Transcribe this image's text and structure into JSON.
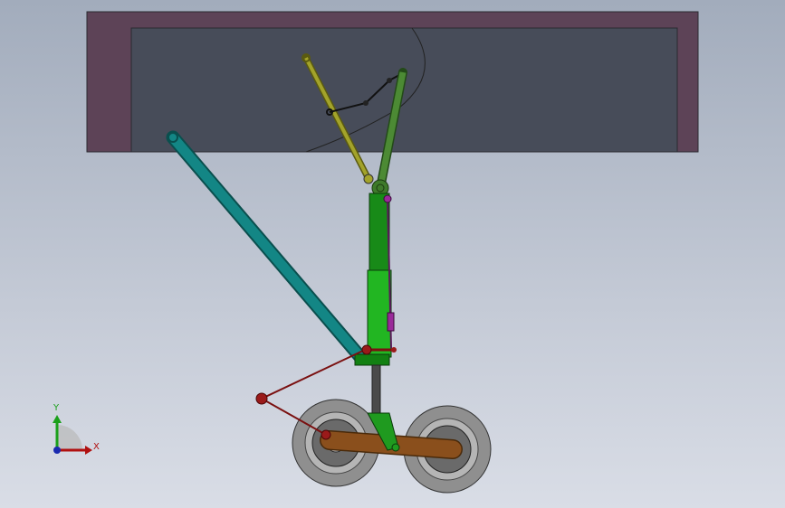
{
  "viewport": {
    "triad": {
      "x_label": "X",
      "y_label": "Y"
    },
    "colors": {
      "bay_outer": "#5d4357",
      "bay_inner": "#474c59",
      "drag_strut": "#0f7a78",
      "yellow_link": "#8a8a1e",
      "green_link": "#3f7a2a",
      "shock_strut": "#19a019",
      "torque_beam": "#8a4f1c",
      "red_link": "#8a1010",
      "tire": "#8a8a8a"
    }
  }
}
